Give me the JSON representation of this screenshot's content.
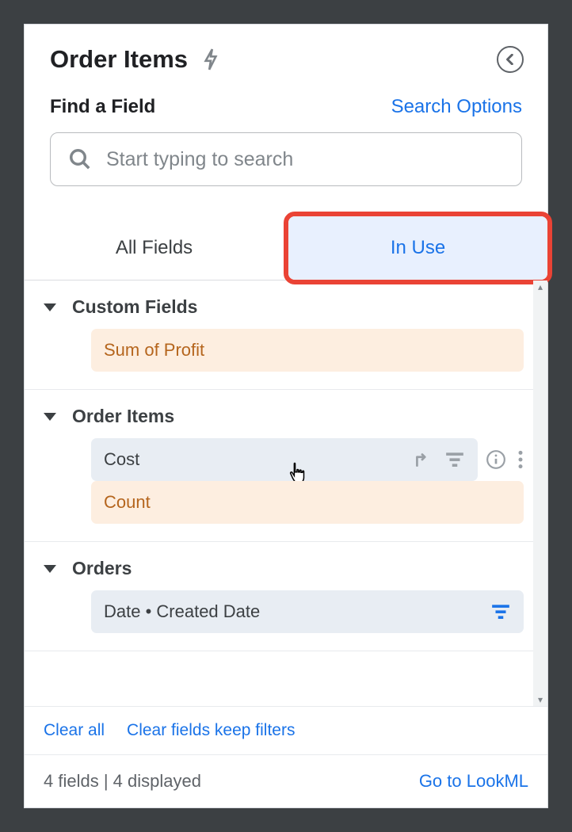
{
  "header": {
    "title": "Order Items"
  },
  "search": {
    "find_label": "Find a Field",
    "options_label": "Search Options",
    "placeholder": "Start typing to search"
  },
  "tabs": {
    "all": "All Fields",
    "in_use": "In Use"
  },
  "sections": [
    {
      "title": "Custom Fields",
      "fields": [
        {
          "label": "Sum of Profit",
          "style": "orange"
        }
      ]
    },
    {
      "title": "Order Items",
      "fields": [
        {
          "label": "Cost",
          "style": "blue",
          "hovered": true
        },
        {
          "label": "Count",
          "style": "orange"
        }
      ]
    },
    {
      "title": "Orders",
      "fields": [
        {
          "label": "Date • Created Date",
          "style": "blue",
          "filtered": true
        }
      ]
    }
  ],
  "footer": {
    "clear_all": "Clear all",
    "clear_keep": "Clear fields keep filters",
    "status": "4 fields | 4 displayed",
    "lookml": "Go to LookML"
  }
}
